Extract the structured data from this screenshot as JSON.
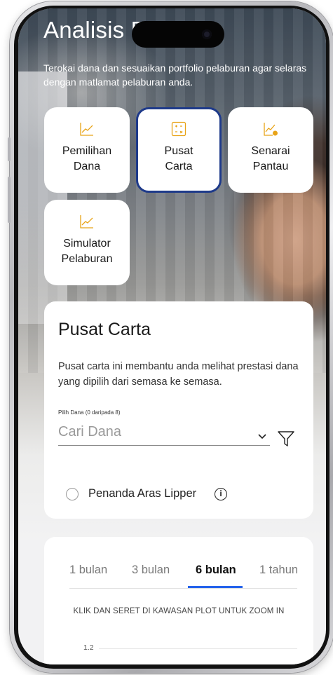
{
  "header": {
    "title": "Analisis Dana",
    "subtitle": "Terokai dana dan sesuaikan portfolio pelaburan agar selaras dengan matlamat pelaburan anda."
  },
  "tiles": [
    {
      "id": "pemilihan",
      "line1": "Pemilihan",
      "line2": "Dana",
      "icon": "line-chart-icon",
      "active": false
    },
    {
      "id": "pusat",
      "line1": "Pusat",
      "line2": "Carta",
      "icon": "grid-chart-icon",
      "active": true
    },
    {
      "id": "senarai",
      "line1": "Senarai",
      "line2": "Pantau",
      "icon": "watchlist-chart-icon",
      "active": false
    },
    {
      "id": "simulator",
      "line1": "Simulator",
      "line2": "Pelaburan",
      "icon": "line-chart-icon",
      "active": false
    }
  ],
  "pusat_carta": {
    "title": "Pusat Carta",
    "description": "Pusat carta ini membantu anda melihat prestasi dana yang dipilih dari semasa ke semasa.",
    "field_label": "Pilih Dana (0 daripada 8)",
    "search_placeholder": "Cari Dana",
    "radio_label": "Penanda Aras Lipper"
  },
  "chart_card": {
    "tabs": [
      "1 bulan",
      "3 bulan",
      "6 bulan",
      "1 tahun"
    ],
    "selected_tab": "6 bulan",
    "zoom_hint": "KLIK DAN SERET DI KAWASAN PLOT UNTUK ZOOM IN",
    "y_tick": "1.2"
  },
  "colors": {
    "accent": "#2563eb",
    "active_tile_border": "#1e3a8a",
    "icon_orange": "#e8a317"
  }
}
